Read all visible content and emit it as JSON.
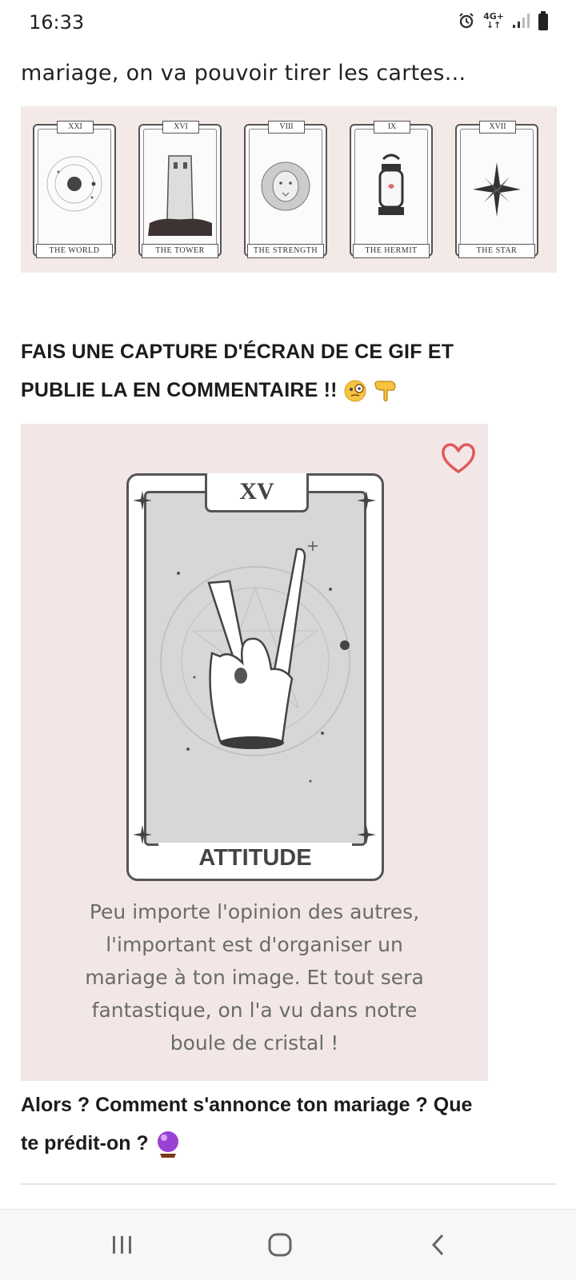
{
  "status_bar": {
    "time": "16:33",
    "network": "4G+"
  },
  "article": {
    "intro_line": "mariage, on va pouvoir tirer les cartes...",
    "tarot_cards": [
      {
        "numeral": "XXI",
        "name": "THE WORLD",
        "icon": "planet-icon"
      },
      {
        "numeral": "XVI",
        "name": "THE TOWER",
        "icon": "tower-icon"
      },
      {
        "numeral": "VIII",
        "name": "THE STRENGTH",
        "icon": "lion-icon"
      },
      {
        "numeral": "IX",
        "name": "THE HERMIT",
        "icon": "lantern-icon"
      },
      {
        "numeral": "XVII",
        "name": "THE STAR",
        "icon": "star-icon"
      }
    ],
    "instruction_line1": "FAIS UNE CAPTURE D'ÉCRAN DE CE GIF ET",
    "instruction_line2": "PUBLIE LA EN COMMENTAIRE !!",
    "gif": {
      "card_numeral": "XV",
      "card_title": "ATTITUDE",
      "caption_lines": [
        "Peu importe l'opinion des autres,",
        "l'important est d'organiser un",
        "mariage à ton image. Et tout sera",
        "fantastique, on l'a vu dans notre",
        "boule de cristal !"
      ]
    },
    "question_line1": "Alors ? Comment s'annonce ton mariage ? Que",
    "question_line2": "te prédit-on ?"
  },
  "colors": {
    "strip_background": "#f3e9e7",
    "gif_background": "#f2e7e6",
    "heart": "#e05a5a"
  }
}
